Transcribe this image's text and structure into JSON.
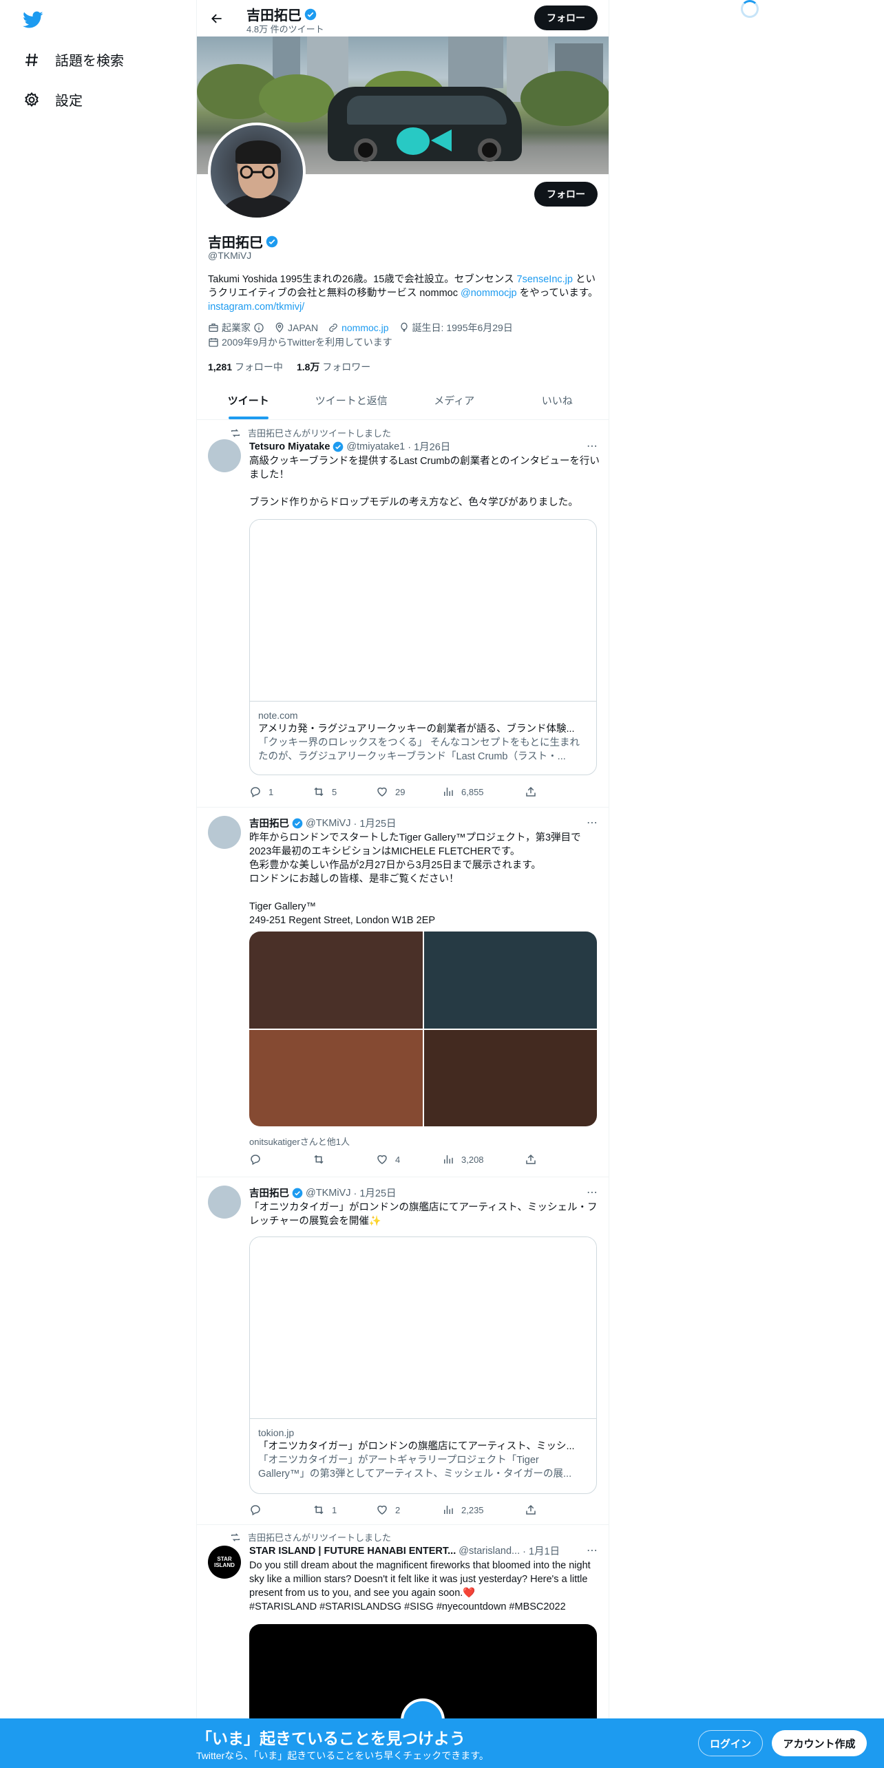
{
  "colors": {
    "accent": "#1d9bf0",
    "text": "#0f1419",
    "muted": "#536471"
  },
  "nav": {
    "explore_label": "話題を検索",
    "settings_label": "設定"
  },
  "header": {
    "name": "吉田拓巳",
    "tweet_count": "4.8万 件のツイート",
    "follow_label": "フォロー"
  },
  "profile": {
    "name": "吉田拓巳",
    "handle": "@TKMiVJ",
    "follow_label": "フォロー",
    "bio_part1": "Takumi Yoshida 1995生まれの26歳。15歳で会社設立。セブンセンス ",
    "bio_link1": "7senseInc.jp",
    "bio_part2": " というクリエイティブの会社と無料の移動サービス nommoc ",
    "bio_link2": "@nommocjp",
    "bio_part3": " をやっています。",
    "bio_link3": "instagram.com/tkmivj/",
    "job": "起業家",
    "location": "JAPAN",
    "website": "nommoc.jp",
    "birthday": "誕生日: 1995年6月29日",
    "joined": "2009年9月からTwitterを利用しています",
    "following_count": "1,281",
    "following_label": "フォロー中",
    "followers_count": "1.8万",
    "followers_label": "フォロワー"
  },
  "tabs": [
    "ツイート",
    "ツイートと返信",
    "メディア",
    "いいね"
  ],
  "tweets": [
    {
      "retweet_note": "吉田拓巳さんがリツイートしました",
      "author": "Tetsuro Miyatake",
      "handle": "@tmiyatake1",
      "date": "· 1月26日",
      "text": "高級クッキーブランドを提供するLast Crumbの創業者とのインタビューを行いました！\n\nブランド作りからドロップモデルの考え方など、色々学びがありました。",
      "card_domain": "note.com",
      "card_title": "アメリカ発・ラグジュアリークッキーの創業者が語る、ブランド体験...",
      "card_desc": "「クッキー界のロレックスをつくる」 そんなコンセプトをもとに生まれたのが、ラグジュアリークッキーブランド「Last Crumb（ラスト・...",
      "replies": "1",
      "retweets": "5",
      "likes": "29",
      "views": "6,855"
    },
    {
      "author": "吉田拓巳",
      "handle": "@TKMiVJ",
      "date": "· 1月25日",
      "text": "昨年からロンドンでスタートしたTiger Gallery™プロジェクト，第3弾目で2023年最初のエキシビションはMICHELE FLETCHERです。\n色彩豊かな美しい作品が2月27日から3月25日まで展示されます。\nロンドンにお越しの皆様、是非ご覧ください！\n\nTiger Gallery™\n249-251 Regent Street, London W1B 2EP",
      "tagline": "onitsukatigerさんと他1人",
      "photo_colors": [
        "#4a3028",
        "#263a44",
        "#854a32",
        "#432a20"
      ],
      "replies": "",
      "retweets": "",
      "likes": "4",
      "views": "3,208"
    },
    {
      "author": "吉田拓巳",
      "handle": "@TKMiVJ",
      "date": "· 1月25日",
      "text": "「オニツカタイガー」がロンドンの旗艦店にてアーティスト、ミッシェル・フレッチャーの展覧会を開催✨",
      "card_domain": "tokion.jp",
      "card_title": "「オニツカタイガー」がロンドンの旗艦店にてアーティスト、ミッシ...",
      "card_desc": "「オニツカタイガー」がアートギャラリープロジェクト「Tiger Gallery™」の第3弾としてアーティスト、ミッシェル・タイガーの展...",
      "replies": "",
      "retweets": "1",
      "likes": "2",
      "views": "2,235"
    },
    {
      "retweet_note": "吉田拓巳さんがリツイートしました",
      "author": "STAR ISLAND | FUTURE HANABI ENTERT...",
      "handle": "@starisland...",
      "date": "· 1月1日",
      "avatar_text": "STAR ISLAND",
      "text": "Do you still dream about the magnificent fireworks that bloomed into the night sky like a million stars? Doesn't it felt like it was just yesterday? Here's a little present from us to you, and see you again soon.❤️",
      "hashtags": "#STARISLAND #STARISLANDSG #SISG #nyecountdown #MBSC2022"
    }
  ],
  "bottom_bar": {
    "title": "「いま」起きていることを見つけよう",
    "subtitle": "Twitterなら、「いま」起きていることをいち早くチェックできます。",
    "login_label": "ログイン",
    "signup_label": "アカウント作成"
  }
}
